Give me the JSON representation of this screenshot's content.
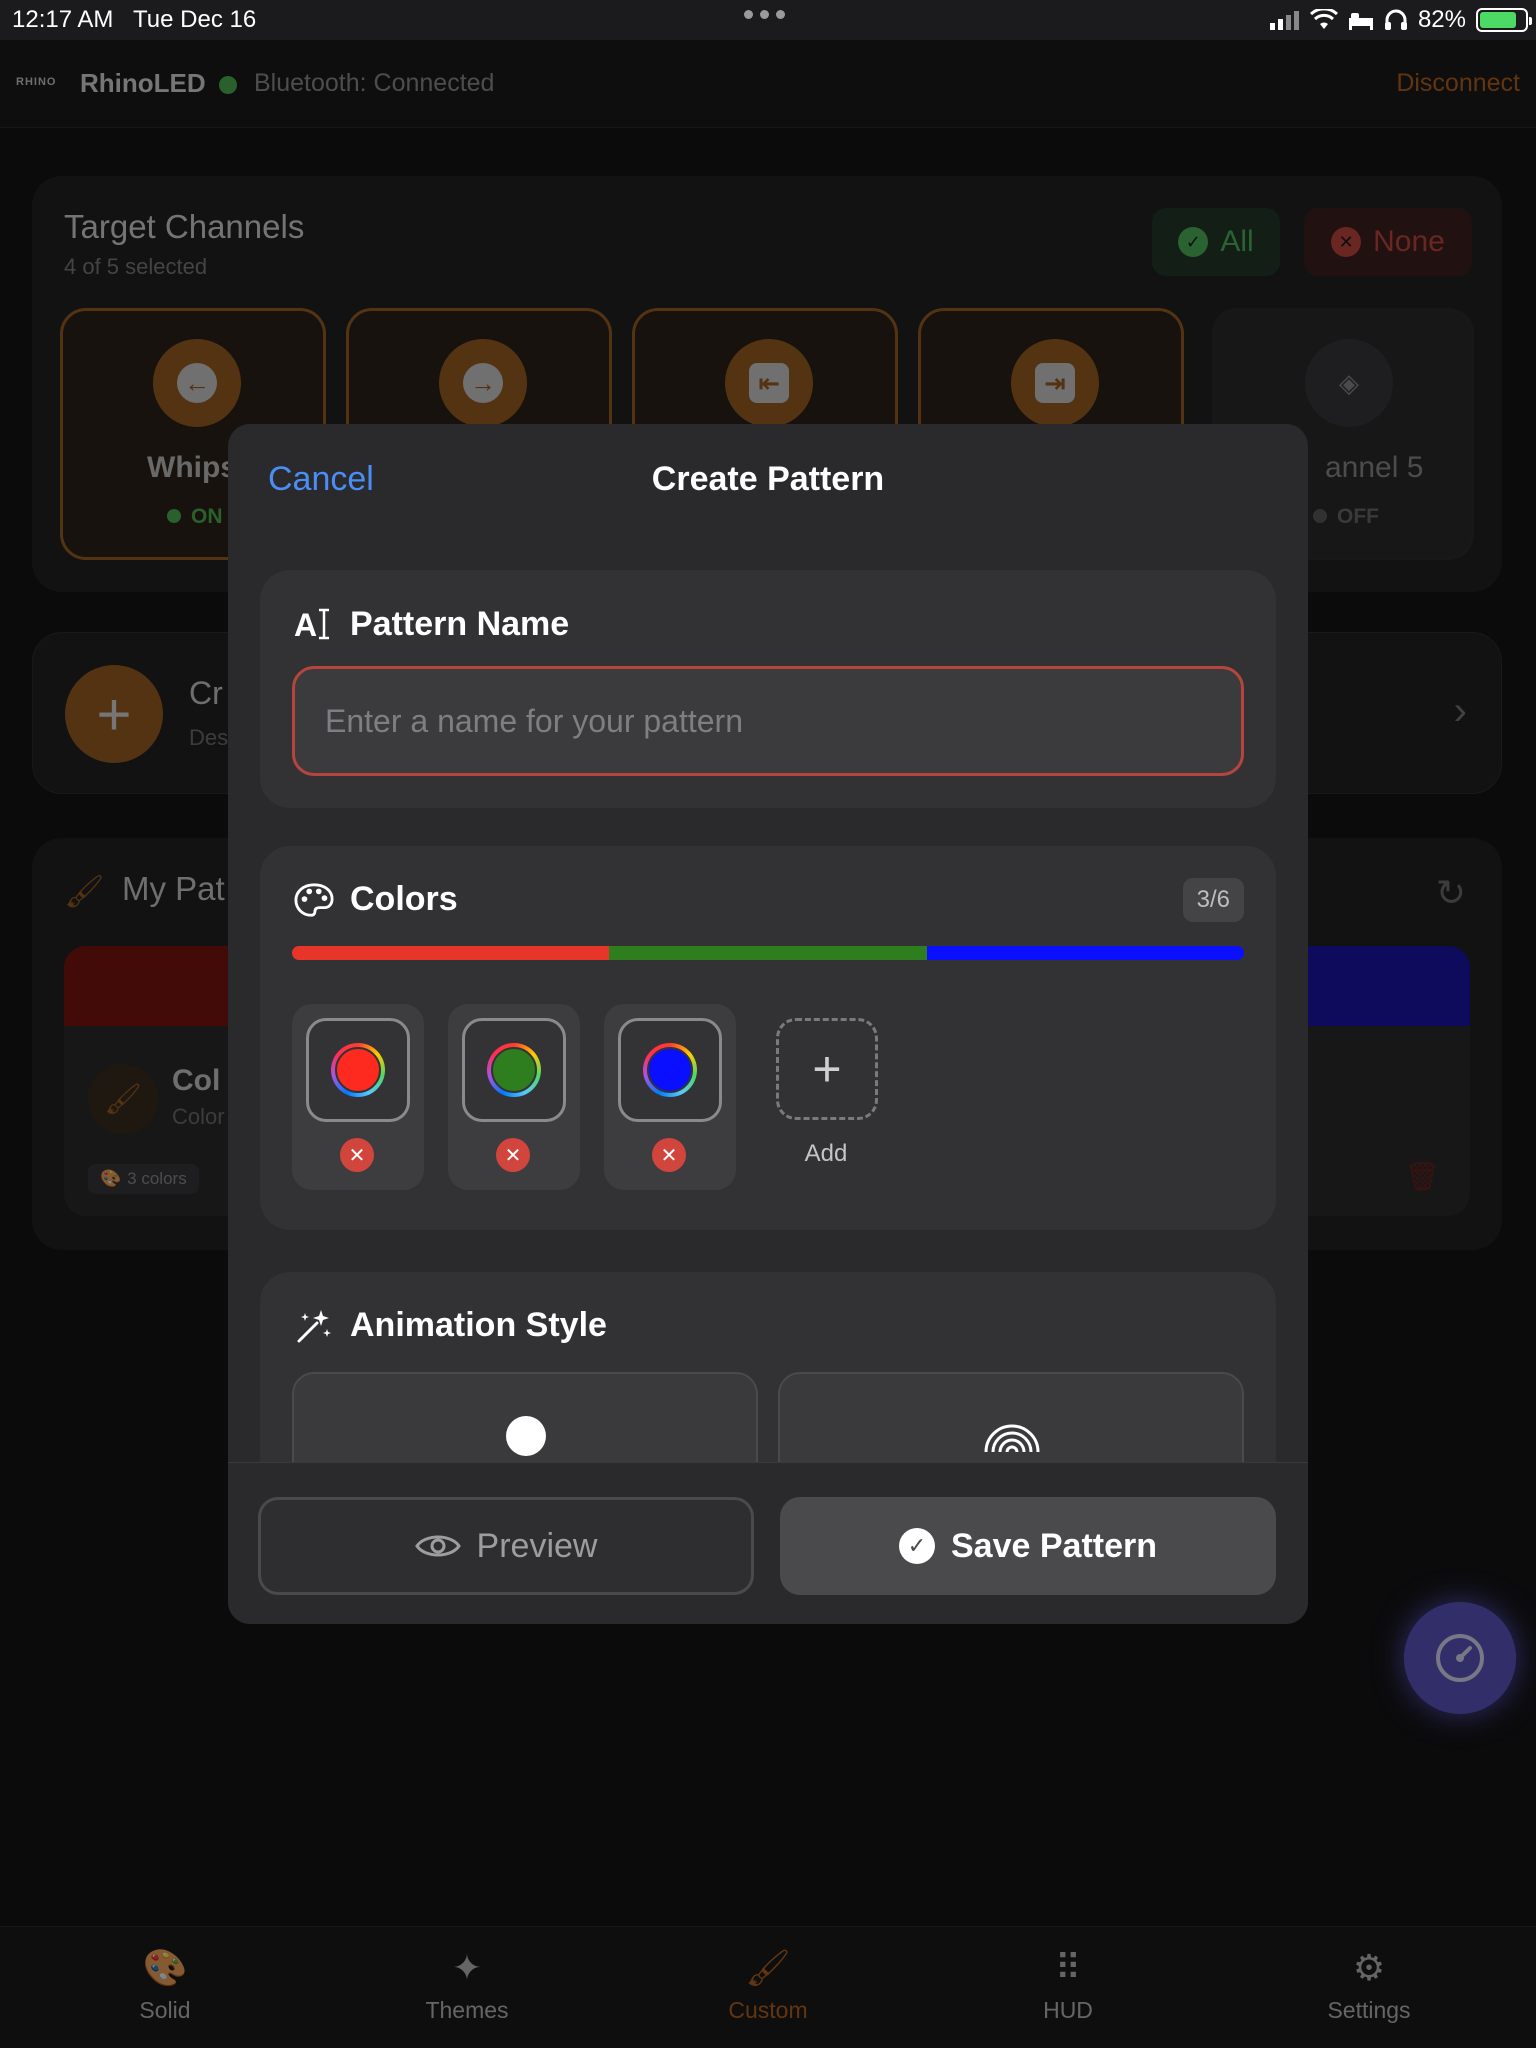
{
  "status_bar": {
    "time": "12:17 AM",
    "date": "Tue Dec 16",
    "battery": "82%"
  },
  "app_bar": {
    "logo_text": "RHINO",
    "app_name": "RhinoLED",
    "bluetooth_status": "Bluetooth: Connected",
    "disconnect_label": "Disconnect"
  },
  "target_channels": {
    "title": "Target Channels",
    "subtitle": "4 of 5 selected",
    "all_label": "All",
    "none_label": "None",
    "channels": [
      {
        "label": "Whips",
        "state": "ON",
        "icon": "arrow-left-circle-icon",
        "glyph": "←",
        "selected": true
      },
      {
        "label": "",
        "state": "",
        "icon": "arrow-right-circle-icon",
        "glyph": "→",
        "selected": true
      },
      {
        "label": "",
        "state": "",
        "icon": "arrow-left-square-icon",
        "glyph": "⇤",
        "selected": true
      },
      {
        "label": "",
        "state": "",
        "icon": "arrow-right-square-icon",
        "glyph": "⇥",
        "selected": true
      },
      {
        "label": "annel 5",
        "state": "OFF",
        "icon": "layers-icon",
        "glyph": "◈",
        "selected": false
      }
    ]
  },
  "create_row": {
    "title": "Cr",
    "subtitle": "Des"
  },
  "my_patterns": {
    "title": "My Pat",
    "card": {
      "name": "Col",
      "description": "Color",
      "tag": "3 colors"
    }
  },
  "modal": {
    "cancel_label": "Cancel",
    "title": "Create Pattern",
    "pattern_name": {
      "heading": "Pattern Name",
      "placeholder": "Enter a name for your pattern",
      "value": ""
    },
    "colors": {
      "heading": "Colors",
      "count": "3/6",
      "swatches": [
        "#ff2a1f",
        "#2e7d1f",
        "#0a10ff"
      ],
      "add_label": "Add"
    },
    "animation_style": {
      "heading": "Animation Style",
      "options": [
        {
          "icon": "solid-dot-icon"
        },
        {
          "icon": "rainbow-icon"
        }
      ]
    },
    "preview_label": "Preview",
    "save_label": "Save Pattern"
  },
  "tab_bar": {
    "tabs": [
      {
        "label": "Solid",
        "icon": "palette-icon",
        "glyph": "🎨",
        "active": false
      },
      {
        "label": "Themes",
        "icon": "sparkles-icon",
        "glyph": "✦",
        "active": false
      },
      {
        "label": "Custom",
        "icon": "paintbrush-icon",
        "glyph": "🖌",
        "active": true
      },
      {
        "label": "HUD",
        "icon": "grid-dots-icon",
        "glyph": "⠿",
        "active": false
      },
      {
        "label": "Settings",
        "icon": "gear-icon",
        "glyph": "⚙",
        "active": false
      }
    ]
  },
  "colors": {
    "accent": "#9a5e22",
    "link": "#4a8df5",
    "error_border": "#b5453d",
    "fab": "#5b55c2"
  }
}
